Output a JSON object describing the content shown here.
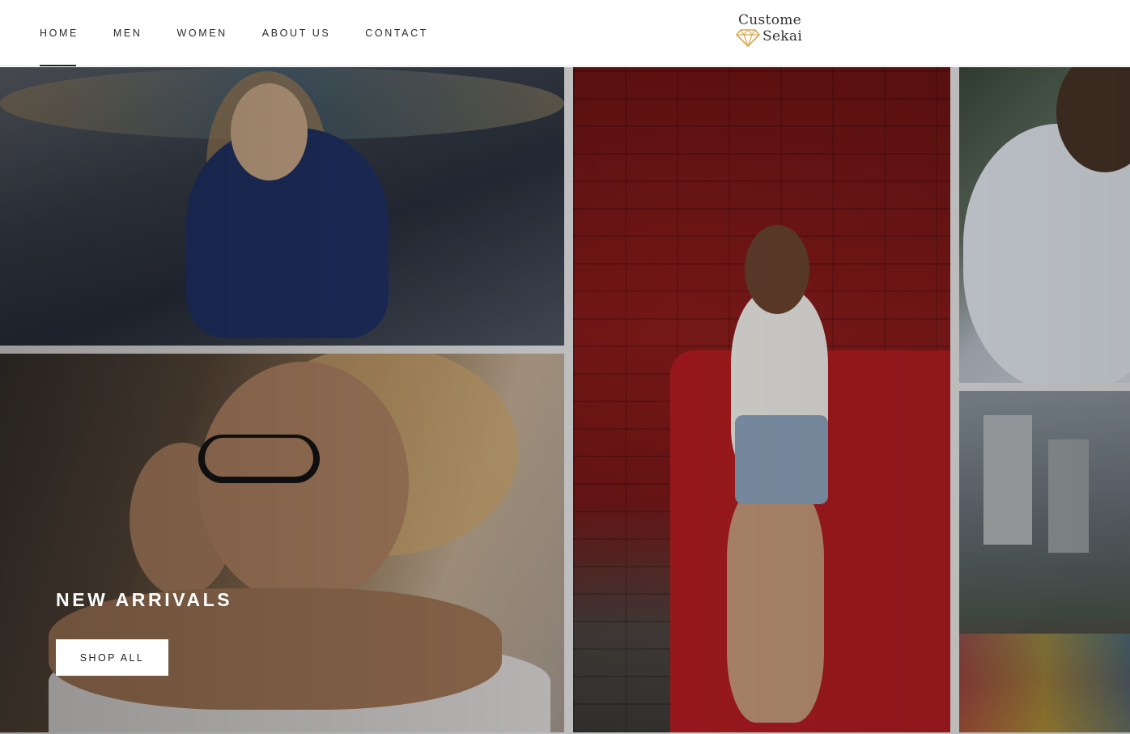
{
  "nav": {
    "items": [
      {
        "label": "HOME",
        "active": true
      },
      {
        "label": "MEN",
        "active": false
      },
      {
        "label": "WOMEN",
        "active": false
      },
      {
        "label": "ABOUT US",
        "active": false
      },
      {
        "label": "CONTACT",
        "active": false
      }
    ]
  },
  "logo": {
    "line1": "Custome",
    "line2": "Sekai",
    "icon": "diamond-icon",
    "icon_color": "#d8a955"
  },
  "hero": {
    "title": "NEW ARRIVALS",
    "cta_label": "SHOP ALL",
    "images": [
      "woman-in-patterned-shirt-photo",
      "couple-portrait-photo",
      "woman-by-red-brick-wall-photo",
      "man-in-white-shirt-photo",
      "city-skyline-photo"
    ]
  }
}
